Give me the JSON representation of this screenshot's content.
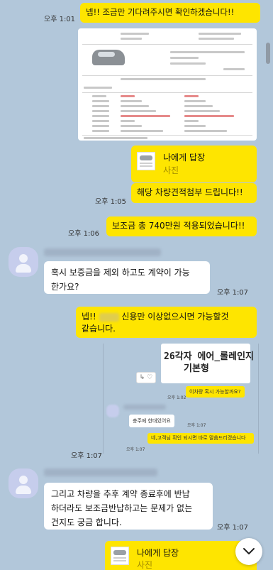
{
  "messages": {
    "m1_text": "넵!! 조금만 기다려주시면 확인하겠습니다!!",
    "m1_time": "오후 1:01",
    "m2_share_title": "나에게 답장",
    "m2_share_sub": "사진",
    "m2_text": "해당 차량견적첨부 드립니다!!",
    "m2_time": "오후 1:05",
    "m3_text": "보조금 총 740만원 적용되었습니다!!",
    "m3_time": "오후 1:06",
    "m4_line1": "혹시 보증금을 제외 하고도 계약이 가능",
    "m4_line2": "한가요?",
    "m4_time": "오후 1:07",
    "m5_prefix": "넵!!",
    "m5_suffix": "신용만 이상없으시면 가능할것",
    "m5_line2": "같습니다.",
    "m6_time": "오후 1:07",
    "m7_line1": "그리고 차량을 추후 계약 종료후에 반납",
    "m7_line2": "하더라도 보조금반납하고는 문제가 없는",
    "m7_line3": "건지도 궁금 합니다.",
    "m7_time": "오후 1:07",
    "m8_share_title": "나에게 답장",
    "m8_share_sub": "사진"
  },
  "capture": {
    "card_line1": "26각자 에어_롤레인지",
    "card_line2": "기본형",
    "tools": "↳ ♡",
    "yellow1": "이차량 혹시 가능할까요?",
    "time1": "오후 1:02",
    "white1": "충주에 한대있어요",
    "time2": "오후 1:07",
    "yellow2": "네,고객님 확인 되시면 바로 말씀드리겠습니다",
    "time3": "오후 1:07"
  },
  "icons": {
    "scroll_down": "chevron-down-icon"
  },
  "colors": {
    "background": "#b2c7da",
    "my_bubble": "#fee500",
    "other_bubble": "#ffffff"
  }
}
